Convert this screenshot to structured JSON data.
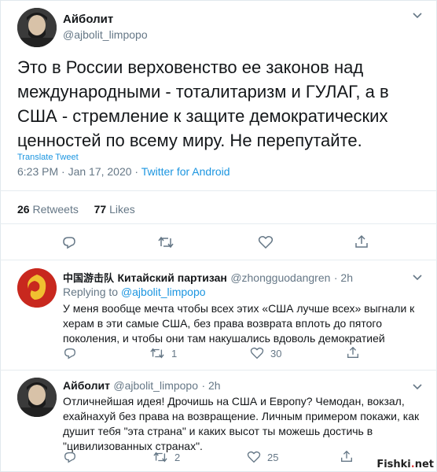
{
  "main": {
    "name": "Айболит",
    "handle": "@ajbolit_limpopo",
    "text": "Это в России верховенство ее законов над международными - тоталитаризм и ГУЛАГ, а в США - стремление к защите демократических ценностей по всему миру. Не перепутайте.",
    "translate": "Translate Tweet",
    "time": "6:23 PM · Jan 17, 2020 · ",
    "source": "Twitter for Android",
    "retweets_count": "26",
    "retweets_label": "Retweets",
    "likes_count": "77",
    "likes_label": "Likes"
  },
  "reply1": {
    "name_cn": "中国游击队",
    "name": "Китайский партизан",
    "handle": "@zhongguodangren",
    "time": "· 2h",
    "replying_prefix": "Replying to ",
    "replying_to": "@ajbolit_limpopo",
    "text": "У меня вообще мечта чтобы всех этих «США лучше всех» выгнали к херам в эти самые США, без права возврата вплоть до пятого поколения, и чтобы они там накушались вдоволь демократией",
    "retweets": "1",
    "likes": "30"
  },
  "reply2": {
    "name": "Айболит",
    "handle": "@ajbolit_limpopo",
    "time": "· 2h",
    "text": "Отличнейшая идея! Дрочишь на США и Европу? Чемодан, вокзал, ехайнахуй без права на возвращение. Личным примером покажи, как душит тебя \"эта страна\" и каких высот ты можешь достичь в \"цивилизованных странах\".",
    "retweets": "2",
    "likes": "25"
  },
  "watermark": {
    "left": "Fishki",
    "dot": ".",
    "right": "net"
  },
  "colors": {
    "link": "#1b95e0",
    "muted": "#657786",
    "text": "#14171a",
    "divider": "#e6ecf0"
  }
}
